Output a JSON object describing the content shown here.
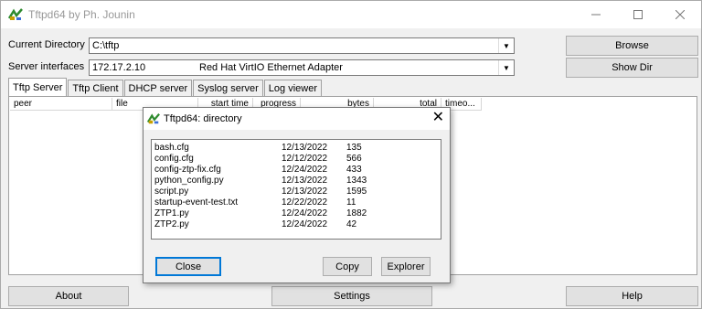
{
  "window": {
    "title": "Tftpd64 by Ph. Jounin",
    "controls": [
      "minimize-icon",
      "maximize-icon",
      "close-icon"
    ]
  },
  "current_directory": {
    "label": "Current Directory",
    "value": "C:\\tftp"
  },
  "server_interfaces": {
    "label": "Server interfaces",
    "ip": "172.17.2.10",
    "adapter": "Red Hat VirtIO Ethernet Adapter"
  },
  "buttons": {
    "browse": "Browse",
    "show_dir": "Show Dir",
    "about": "About",
    "settings": "Settings",
    "help": "Help"
  },
  "tabs": [
    "Tftp Server",
    "Tftp Client",
    "DHCP server",
    "Syslog server",
    "Log viewer"
  ],
  "active_tab": "Tftp Server",
  "columns": [
    "peer",
    "file",
    "start time",
    "progress",
    "bytes",
    "total",
    "timeo..."
  ],
  "dialog": {
    "title": "Tftpd64: directory",
    "files": [
      {
        "name": "bash.cfg",
        "date": "12/13/2022",
        "size": "135"
      },
      {
        "name": "config.cfg",
        "date": "12/12/2022",
        "size": "566"
      },
      {
        "name": "config-ztp-fix.cfg",
        "date": "12/24/2022",
        "size": "433"
      },
      {
        "name": "python_config.py",
        "date": "12/13/2022",
        "size": "1343"
      },
      {
        "name": "script.py",
        "date": "12/13/2022",
        "size": "1595"
      },
      {
        "name": "startup-event-test.txt",
        "date": "12/22/2022",
        "size": "11"
      },
      {
        "name": "ZTP1.py",
        "date": "12/24/2022",
        "size": "1882"
      },
      {
        "name": "ZTP2.py",
        "date": "12/24/2022",
        "size": "42"
      }
    ],
    "buttons": {
      "close": "Close",
      "copy": "Copy",
      "explorer": "Explorer"
    }
  }
}
